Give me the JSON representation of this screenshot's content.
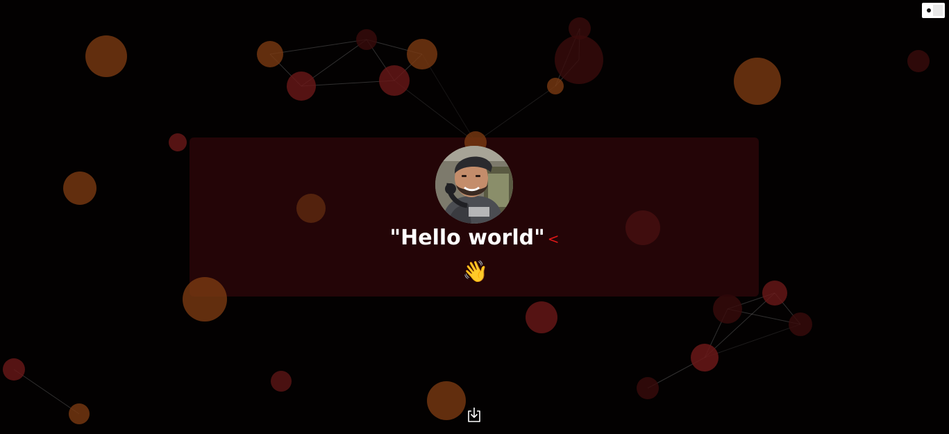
{
  "theme_toggle": {
    "icon": "theme-toggle-icon",
    "background": "#ffffff"
  },
  "hero": {
    "headline": "\"Hello world\"",
    "typing_cursor": "<",
    "wave_emoji": "👋",
    "avatar": "profile-photo"
  },
  "footer": {
    "download_icon": "download-icon"
  },
  "colors": {
    "background": "#030101",
    "card": "#2c0608",
    "particle_orange": "#7a3a12",
    "particle_red": "#5c1616",
    "particle_dark_red": "#2e0808",
    "cursor": "#e01818"
  }
}
